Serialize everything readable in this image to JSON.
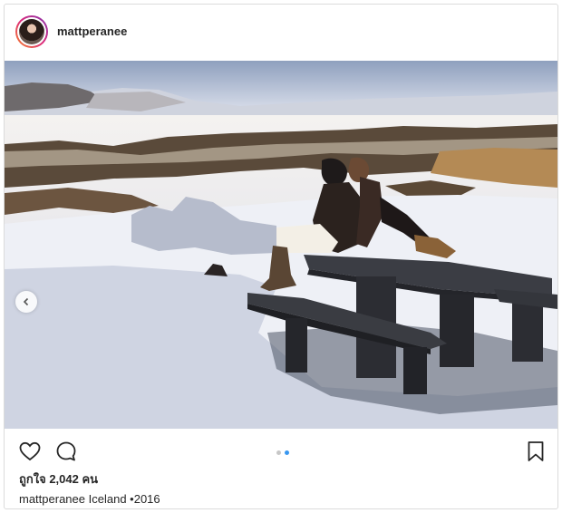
{
  "post": {
    "username": "mattperanee",
    "likes_text": "ถูกใจ 2,042 คน",
    "caption_user": "mattperanee",
    "caption_text": "Iceland •2016",
    "carousel": {
      "count": 2,
      "active_index": 1
    }
  },
  "icons": {
    "like": "heart-icon",
    "comment": "comment-icon",
    "save": "bookmark-icon",
    "prev": "chevron-left-icon"
  },
  "colors": {
    "accent": "#3897f0",
    "text": "#262626",
    "border": "#dbdbdb"
  }
}
